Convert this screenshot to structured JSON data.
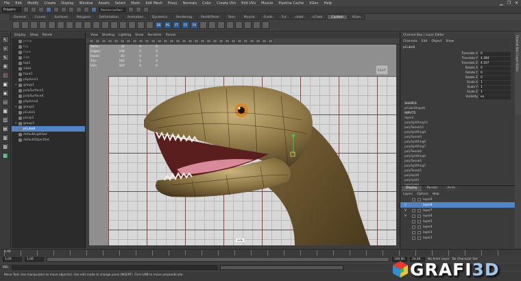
{
  "menubar": {
    "items": [
      "File",
      "Edit",
      "Modify",
      "Create",
      "Display",
      "Window",
      "Assets",
      "Select",
      "Mesh",
      "Edit Mesh",
      "Proxy",
      "Normals",
      "Color",
      "Create UVs",
      "Edit UVs",
      "Muscle",
      "Pipeline Cache",
      "XGen",
      "Help"
    ]
  },
  "statusline": {
    "mode": "Polygons",
    "field": "Receive surface"
  },
  "shelf": {
    "tabs": [
      "General",
      "Curves",
      "Surfaces",
      "Polygons",
      "Deformation",
      "Animation",
      "Dynamics",
      "Rendering",
      "PaintEffects",
      "Toon",
      "Muscle",
      "Fluids",
      "Fur",
      "nHair",
      "nCloth",
      "Custom",
      "XGen"
    ],
    "active_tab": "Custom",
    "icons": [
      "",
      "",
      "",
      "",
      "",
      "",
      "",
      "",
      "",
      "",
      "",
      "",
      "",
      "",
      "",
      "",
      "DS",
      "PS",
      "FT",
      "CF",
      "FX",
      "",
      "",
      "",
      "",
      "",
      "",
      "",
      ""
    ]
  },
  "toolbox": {
    "tools": [
      {
        "icon": "select-tool-icon",
        "glyph": "↖"
      },
      {
        "icon": "lasso-tool-icon",
        "glyph": "✧"
      },
      {
        "icon": "paint-select-icon",
        "glyph": "✎"
      },
      {
        "icon": "move-tool-icon",
        "glyph": "✥"
      },
      {
        "icon": "rotate-tool-icon",
        "glyph": "↻"
      },
      {
        "icon": "scale-tool-icon",
        "glyph": "▣"
      },
      {
        "icon": "last-tool-icon",
        "glyph": "◆"
      },
      {
        "icon": "layout-single-icon",
        "glyph": "▭"
      },
      {
        "icon": "layout-four-icon",
        "glyph": "▦"
      },
      {
        "icon": "layout-split-icon",
        "glyph": "◫"
      },
      {
        "icon": "layout-outliner-icon",
        "glyph": "▤"
      },
      {
        "icon": "layout-graph-icon",
        "glyph": "▥"
      },
      {
        "icon": "layout-persp-icon",
        "glyph": "▧"
      },
      {
        "icon": "layout-custom-icon",
        "glyph": "▨"
      }
    ]
  },
  "outliner": {
    "menu": [
      "Display",
      "Show",
      "Panels"
    ],
    "items": [
      {
        "label": "persp",
        "plus": false,
        "dim": true
      },
      {
        "label": "top",
        "plus": false,
        "dim": true
      },
      {
        "label": "front",
        "plus": false,
        "dim": true
      },
      {
        "label": "side",
        "plus": false,
        "dim": true
      },
      {
        "label": "top1",
        "plus": false,
        "dim": false
      },
      {
        "label": "side1",
        "plus": false,
        "dim": false
      },
      {
        "label": "front1",
        "plus": false,
        "dim": false
      },
      {
        "label": "pSphere1",
        "plus": false,
        "dim": false
      },
      {
        "label": "group1",
        "plus": true,
        "dim": false
      },
      {
        "label": "polySurface1",
        "plus": false,
        "dim": false
      },
      {
        "label": "polySurface4",
        "plus": false,
        "dim": false
      },
      {
        "label": "pSphere2",
        "plus": false,
        "dim": false
      },
      {
        "label": "group2",
        "plus": true,
        "dim": false
      },
      {
        "label": "pCube1",
        "plus": false,
        "dim": false
      },
      {
        "label": "persp1",
        "plus": false,
        "dim": false
      },
      {
        "label": "group3",
        "plus": true,
        "dim": false
      },
      {
        "label": "pCube6",
        "plus": false,
        "dim": false,
        "selected": true
      },
      {
        "label": "defaultLightSet",
        "plus": false,
        "dim": false
      },
      {
        "label": "defaultObjectSet",
        "plus": false,
        "dim": false
      }
    ]
  },
  "viewport": {
    "menu": [
      "View",
      "Shading",
      "Lighting",
      "Show",
      "Renderer",
      "Panels"
    ],
    "hud": [
      {
        "label": "Verts:",
        "v1": "32",
        "v2": "0",
        "v3": "0"
      },
      {
        "label": "Edges:",
        "v1": "248",
        "v2": "0",
        "v3": "0"
      },
      {
        "label": "Faces:",
        "v1": "83",
        "v2": "0",
        "v3": "0"
      },
      {
        "label": "Tris:",
        "v1": "162",
        "v2": "0",
        "v3": "0"
      },
      {
        "label": "UVs:",
        "v1": "424",
        "v2": "0",
        "v3": "0"
      }
    ],
    "view_cube": "RIGHT",
    "camera_label": "side"
  },
  "channelbox": {
    "title": "Channel Box / Layer Editor",
    "menu": [
      "Channels",
      "Edit",
      "Object",
      "Show"
    ],
    "object": "pCube6",
    "attributes": [
      {
        "name": "Translate X",
        "value": "0"
      },
      {
        "name": "Translate Y",
        "value": "4.384"
      },
      {
        "name": "Translate Z",
        "value": "4.107"
      },
      {
        "name": "Rotate X",
        "value": "0"
      },
      {
        "name": "Rotate Y",
        "value": "0"
      },
      {
        "name": "Rotate Z",
        "value": "0"
      },
      {
        "name": "Scale X",
        "value": "1"
      },
      {
        "name": "Scale Y",
        "value": "1"
      },
      {
        "name": "Scale Z",
        "value": "1"
      },
      {
        "name": "Visibility",
        "value": "on"
      }
    ],
    "shapes_header": "SHAPES",
    "shapes": [
      "pCubeShape6"
    ],
    "inputs_header": "INPUTS",
    "inputs": [
      "layer4",
      "polySplitRing10",
      "polyTweak10",
      "polySplitRing9",
      "polyTweak9",
      "polySplitRing8",
      "polySplitRing7",
      "polyTweak8",
      "polySplitRing6",
      "polyTweak6",
      "polySplitRing5",
      "polyTweak5",
      "polySplit6",
      "polySplit5",
      "polySplit4"
    ],
    "side_tab": "Channel Box / Layer Editor"
  },
  "layers": {
    "tabs": [
      "Display",
      "Render",
      "Anim"
    ],
    "active_tab": "Display",
    "menu": [
      "Layers",
      "Options",
      "Help"
    ],
    "rows": [
      {
        "vis": "",
        "label": "layer9"
      },
      {
        "vis": "V",
        "label": "layer8",
        "selected": true
      },
      {
        "vis": "V",
        "label": "layer7"
      },
      {
        "vis": "V",
        "label": "layer6"
      },
      {
        "vis": "",
        "label": "layer5"
      },
      {
        "vis": "",
        "label": "layer4"
      },
      {
        "vis": "",
        "label": "layer3"
      },
      {
        "vis": "",
        "label": "layer2"
      }
    ]
  },
  "timeline": {
    "current": "1.00",
    "range_start": "1.00",
    "range_inner": "1.00",
    "range_end": "24",
    "end": "100.00",
    "end2": "24.00",
    "anim_layer": "No Anim Layer",
    "char_set": "No Character Set"
  },
  "cmdline": {
    "label": "MEL"
  },
  "helpline": {
    "text": "Move Tool: Use manipulator to move object(s). Use edit mode to change pivot (INSERT). Ctrl+LMB to move perpendicular."
  },
  "logo": {
    "text": "GRAFI3D"
  }
}
